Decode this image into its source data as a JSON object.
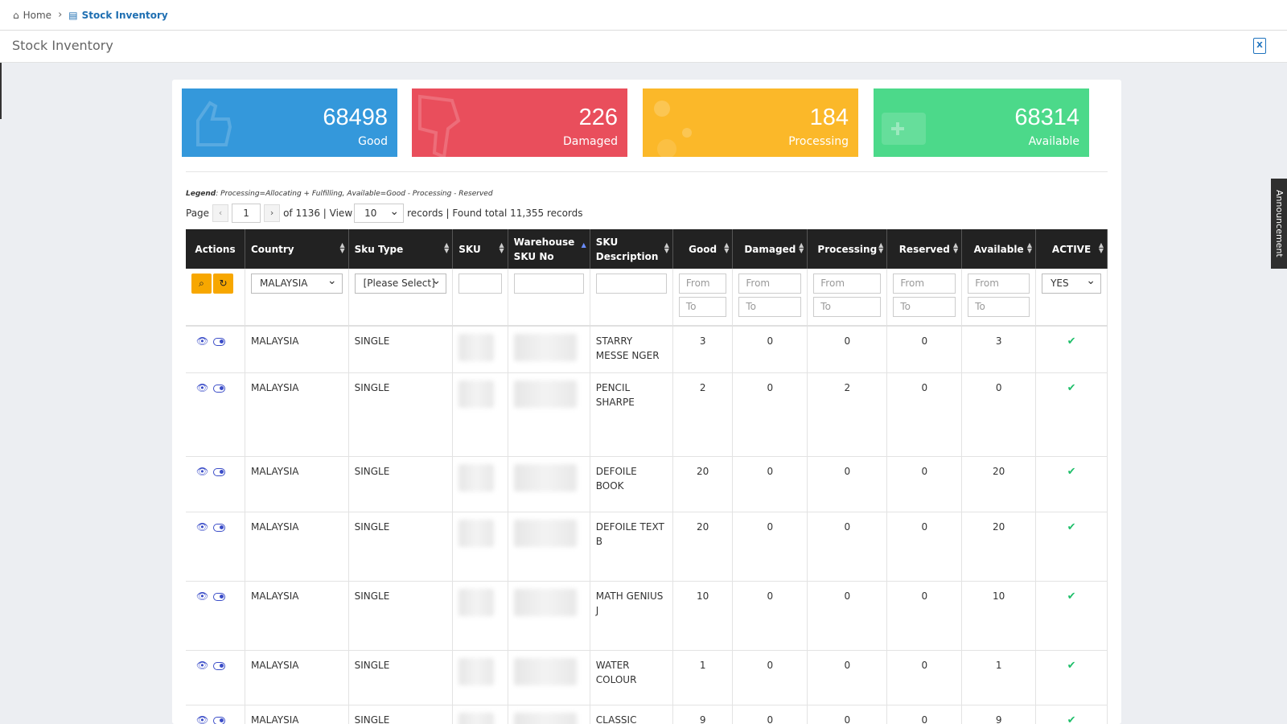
{
  "breadcrumb": {
    "home": "Home",
    "current": "Stock Inventory"
  },
  "page_title": "Stock Inventory",
  "export_icon": "excel-export-icon",
  "cards": [
    {
      "value": "68498",
      "label": "Good",
      "color": "#3498db",
      "icon": "thumbs-up-icon"
    },
    {
      "value": "226",
      "label": "Damaged",
      "color": "#e94e5c",
      "icon": "thumbs-down-icon"
    },
    {
      "value": "184",
      "label": "Processing",
      "color": "#fbb829",
      "icon": "bubbles-icon"
    },
    {
      "value": "68314",
      "label": "Available",
      "color": "#4cd98a",
      "icon": "box-plus-icon"
    }
  ],
  "legend": {
    "title": "Legend",
    "text": ": Processing=Allocating + Fulfilling, Available=Good - Processing - Reserved"
  },
  "pager": {
    "page_label": "Page",
    "prev": "‹",
    "page": "1",
    "next": "›",
    "of_text": "of 1136 | View",
    "view": "10",
    "records_text": "records | Found total 11,355 records"
  },
  "columns": {
    "actions": "Actions",
    "country": "Country",
    "sku_type": "Sku Type",
    "sku": "SKU",
    "wh_sku": "Warehouse SKU No",
    "desc": "SKU Description",
    "good": "Good",
    "damaged": "Damaged",
    "processing": "Processing",
    "reserved": "Reserved",
    "available": "Available",
    "active": "ACTIVE"
  },
  "filters": {
    "country": "MALAYSIA",
    "sku_type": "[Please Select]",
    "active": "YES",
    "from": "From",
    "to": "To"
  },
  "rows": [
    {
      "country": "MALAYSIA",
      "type": "SINGLE",
      "desc": "STARRY MESSE NGER",
      "good": "3",
      "damaged": "0",
      "processing": "0",
      "reserved": "0",
      "available": "3"
    },
    {
      "country": "MALAYSIA",
      "type": "SINGLE",
      "desc": "PENCIL SHARPE",
      "good": "2",
      "damaged": "0",
      "processing": "2",
      "reserved": "0",
      "available": "0"
    },
    {
      "country": "MALAYSIA",
      "type": "SINGLE",
      "desc": "DEFOILE BOOK",
      "good": "20",
      "damaged": "0",
      "processing": "0",
      "reserved": "0",
      "available": "20"
    },
    {
      "country": "MALAYSIA",
      "type": "SINGLE",
      "desc": "DEFOILE TEXT B",
      "good": "20",
      "damaged": "0",
      "processing": "0",
      "reserved": "0",
      "available": "20"
    },
    {
      "country": "MALAYSIA",
      "type": "SINGLE",
      "desc": "MATH GENIUS J",
      "good": "10",
      "damaged": "0",
      "processing": "0",
      "reserved": "0",
      "available": "10"
    },
    {
      "country": "MALAYSIA",
      "type": "SINGLE",
      "desc": "WATER COLOUR",
      "good": "1",
      "damaged": "0",
      "processing": "0",
      "reserved": "0",
      "available": "1"
    },
    {
      "country": "MALAYSIA",
      "type": "SINGLE",
      "desc": "CLASSIC PENCIL",
      "good": "9",
      "damaged": "0",
      "processing": "0",
      "reserved": "0",
      "available": "9"
    }
  ],
  "announcement": "Announcement"
}
